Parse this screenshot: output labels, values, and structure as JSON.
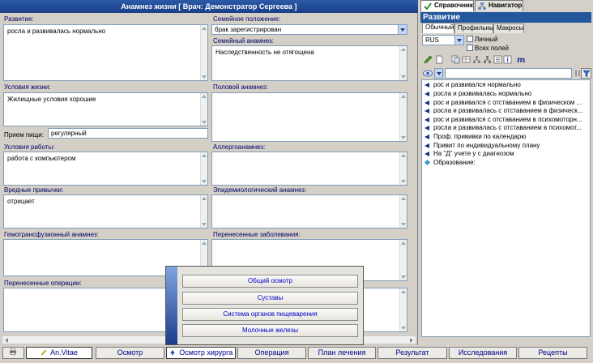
{
  "window": {
    "title": "Анамнез жизни  [ Врач: Демонстратор Сергеева ]"
  },
  "form": {
    "development": {
      "label": "Развитие:",
      "value": "росла и развивалась нормально"
    },
    "marital_status": {
      "label": "Семейное положение:",
      "value": "брак зарегистрирован"
    },
    "family_history": {
      "label": "Семейный анамнез:",
      "value": "Наследственность не отягощена"
    },
    "living_conditions": {
      "label": "Условия жизни:",
      "value": "Жилищные условия хорошие"
    },
    "sexual_history": {
      "label": "Половой анамнез:",
      "value": ""
    },
    "meals": {
      "label": "Прием пищи:",
      "value": "регулярный"
    },
    "work_conditions": {
      "label": "Условия работы:",
      "value": "работа с компьютером"
    },
    "allergy_history": {
      "label": "Аллергоанамнез:",
      "value": ""
    },
    "bad_habits": {
      "label": "Вредные привычки:",
      "value": "отрицает"
    },
    "epidemiological": {
      "label": "Эпидемиологический анамнез:",
      "value": ""
    },
    "transfusion": {
      "label": "Гемотрансфузионный анамнез:",
      "value": ""
    },
    "past_diseases": {
      "label": "Перенесенные заболевания:",
      "value": ""
    },
    "past_operations": {
      "label": "Перенесенные операции:",
      "value": ""
    }
  },
  "popup_menu": {
    "items": [
      "Общий осмотр",
      "Суставы",
      "Система органов пищеварения",
      "Молочные железы"
    ]
  },
  "bottom_toolbar": {
    "buttons": [
      "An.Vitae",
      "Осмотр",
      "Осмотр хирурга",
      "Операция",
      "План лечения",
      "Результат",
      "Исследования",
      "Рецепты"
    ]
  },
  "right_panel": {
    "tabs": [
      "Справочник",
      "Навигатор"
    ],
    "header": "Развитие",
    "subtabs": [
      "Обычный",
      "Профильный",
      "Макросы"
    ],
    "language": "RUS",
    "checkbox_personal": "Личный",
    "checkbox_all_fields": "Всех полей",
    "search_value": "",
    "list_items": [
      {
        "text": "рос и развивался нормально",
        "marker": "arrow"
      },
      {
        "text": "росла и развивалась нормально",
        "marker": "arrow"
      },
      {
        "text": "рос и развивался с отставанием в физическом ...",
        "marker": "arrow"
      },
      {
        "text": "росла и развивалась с отставанием в физическ...",
        "marker": "arrow"
      },
      {
        "text": "рос и развивался с отставанием в психомоторн...",
        "marker": "arrow"
      },
      {
        "text": "росла и развивалась с отставанием в психомот...",
        "marker": "arrow"
      },
      {
        "text": "Проф. прививки по календарю",
        "marker": "arrow"
      },
      {
        "text": "Привит по индивидуальному плану",
        "marker": "arrow"
      },
      {
        "text": "На \"Д\" учете у  с диагнозом",
        "marker": "arrow"
      },
      {
        "text": "Образование:",
        "marker": "diamond"
      }
    ]
  },
  "colors": {
    "title_bar": "#1b3f86",
    "panel_header": "#23579d",
    "label_text": "#000066",
    "button_text": "#00008b"
  }
}
